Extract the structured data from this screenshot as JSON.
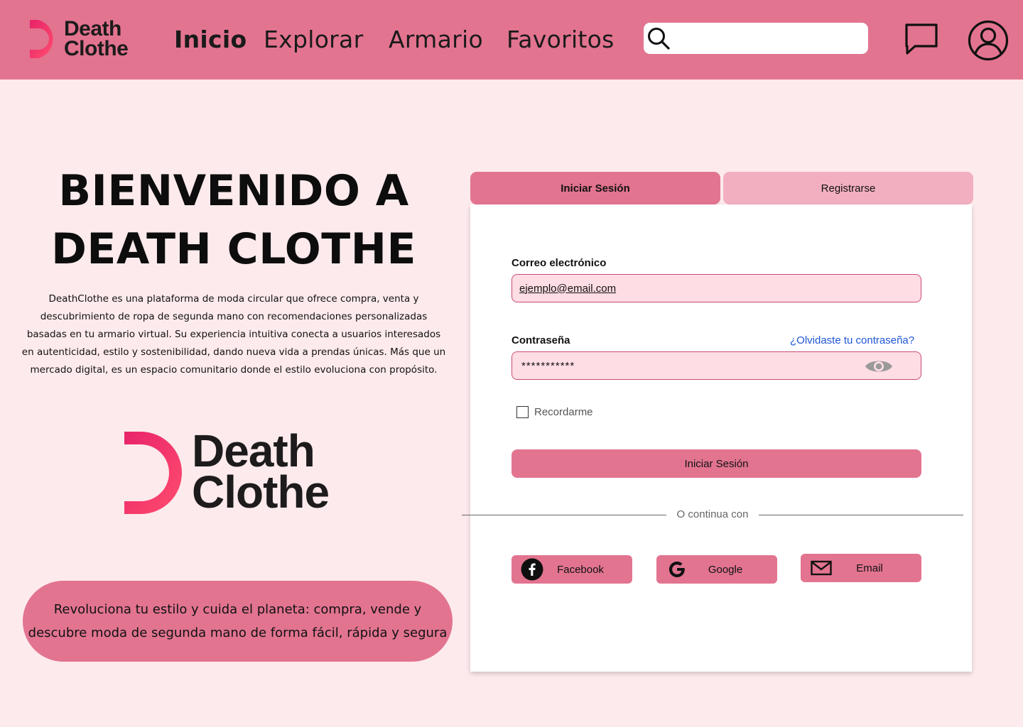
{
  "header": {
    "logo_line1": "Death",
    "logo_line2": "Clothe",
    "nav": [
      {
        "label": "Inicio",
        "active": true
      },
      {
        "label": "Explorar",
        "active": false
      },
      {
        "label": "Armario",
        "active": false
      },
      {
        "label": "Favoritos",
        "active": false
      }
    ],
    "search_placeholder": "",
    "icons": [
      "search-icon",
      "chat-icon",
      "user-icon"
    ]
  },
  "hero": {
    "title_line1": "BIENVENIDO A",
    "title_line2": "DEATH CLOTHE",
    "description": "DeathClothe es una plataforma de moda circular que ofrece compra, venta y descubrimiento de ropa de segunda mano con recomendaciones personalizadas basadas en tu armario virtual. Su experiencia intuitiva conecta a usuarios interesados en autenticidad, estilo y sostenibilidad, dando nueva vida a prendas únicas. Más que un mercado digital, es un espacio comunitario donde el estilo evoluciona con propósito.",
    "logo_line1": "Death",
    "logo_line2": "Clothe",
    "slogan": "Revoluciona tu estilo y cuida el planeta: compra, vende y descubre moda de segunda mano de forma fácil, rápida y segura"
  },
  "auth": {
    "tabs": {
      "login": "Iniciar Sesión",
      "register": "Registrarse"
    },
    "email_label": "Correo electrónico",
    "email_value": "ejemplo@email.com",
    "password_label": "Contraseña",
    "password_value": "***********",
    "forgot_link": "¿Olvidaste tu contraseña?",
    "remember_label": "Recordarme",
    "remember_checked": false,
    "submit_label": "Iniciar Sesión",
    "divider_text": "O continua con",
    "social": [
      {
        "label": "Facebook",
        "icon": "facebook-icon"
      },
      {
        "label": "Google",
        "icon": "google-icon"
      },
      {
        "label": "Email",
        "icon": "mail-icon"
      }
    ]
  },
  "colors": {
    "brand_pink": "#e27490",
    "background": "#fdeaec",
    "tab_inactive": "#f2afbf",
    "input_fill": "#ffdde5",
    "logo_accent": "#ff3d6e",
    "link_blue": "#1e56d6"
  }
}
